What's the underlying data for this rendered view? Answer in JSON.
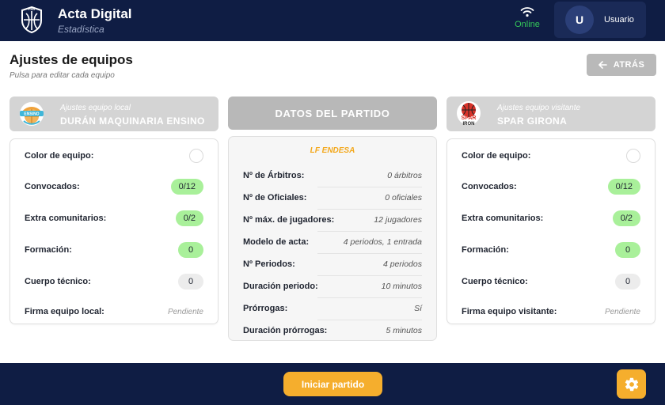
{
  "header": {
    "app_title": "Acta Digital",
    "app_subtitle": "Estadística",
    "logo_text": "FEB",
    "status_label": "Online",
    "user_initial": "U",
    "user_name": "Usuario"
  },
  "page": {
    "title": "Ajustes de equipos",
    "subtitle": "Pulsa para editar cada equipo",
    "back_label": "ATRÁS"
  },
  "local_team": {
    "caption": "Ajustes equipo local",
    "name": "DURÁN MAQUINARIA ENSINO",
    "logo_text": "ENSINO",
    "rows": {
      "color_label": "Color de equipo:",
      "called_label": "Convocados:",
      "called_value": "0/12",
      "extra_label": "Extra comunitarios:",
      "extra_value": "0/2",
      "formation_label": "Formación:",
      "formation_value": "0",
      "staff_label": "Cuerpo técnico:",
      "staff_value": "0",
      "signature_label": "Firma equipo local:",
      "signature_value": "Pendiente"
    }
  },
  "visitor_team": {
    "caption": "Ajustes equipo visitante",
    "name": "SPAR GIRONA",
    "logo_text_1": "SPAR",
    "logo_text_2": "IRON",
    "rows": {
      "color_label": "Color de equipo:",
      "called_label": "Convocados:",
      "called_value": "0/12",
      "extra_label": "Extra comunitarios:",
      "extra_value": "0/2",
      "formation_label": "Formación:",
      "formation_value": "0",
      "staff_label": "Cuerpo técnico:",
      "staff_value": "0",
      "signature_label": "Firma equipo visitante:",
      "signature_value": "Pendiente"
    }
  },
  "match": {
    "header": "DATOS DEL PARTIDO",
    "league": "LF ENDESA",
    "rows": [
      {
        "label": "Nº de Árbitros:",
        "value": "0 árbitros"
      },
      {
        "label": "Nº de Oficiales:",
        "value": "0 oficiales"
      },
      {
        "label": "Nº máx. de jugadores:",
        "value": "12 jugadores"
      },
      {
        "label": "Modelo de acta:",
        "value": "4 periodos, 1 entrada"
      },
      {
        "label": "Nº Periodos:",
        "value": "4 periodos"
      },
      {
        "label": "Duración periodo:",
        "value": "10 minutos"
      },
      {
        "label": "Prórrogas:",
        "value": "Sí"
      },
      {
        "label": "Duración prórrogas:",
        "value": "5 minutos"
      }
    ]
  },
  "footer": {
    "start_label": "Iniciar partido"
  },
  "colors": {
    "navy": "#0f1d44",
    "accent_orange": "#f5ae2d",
    "online_green": "#34c759",
    "pill_green": "#a9f09a"
  }
}
